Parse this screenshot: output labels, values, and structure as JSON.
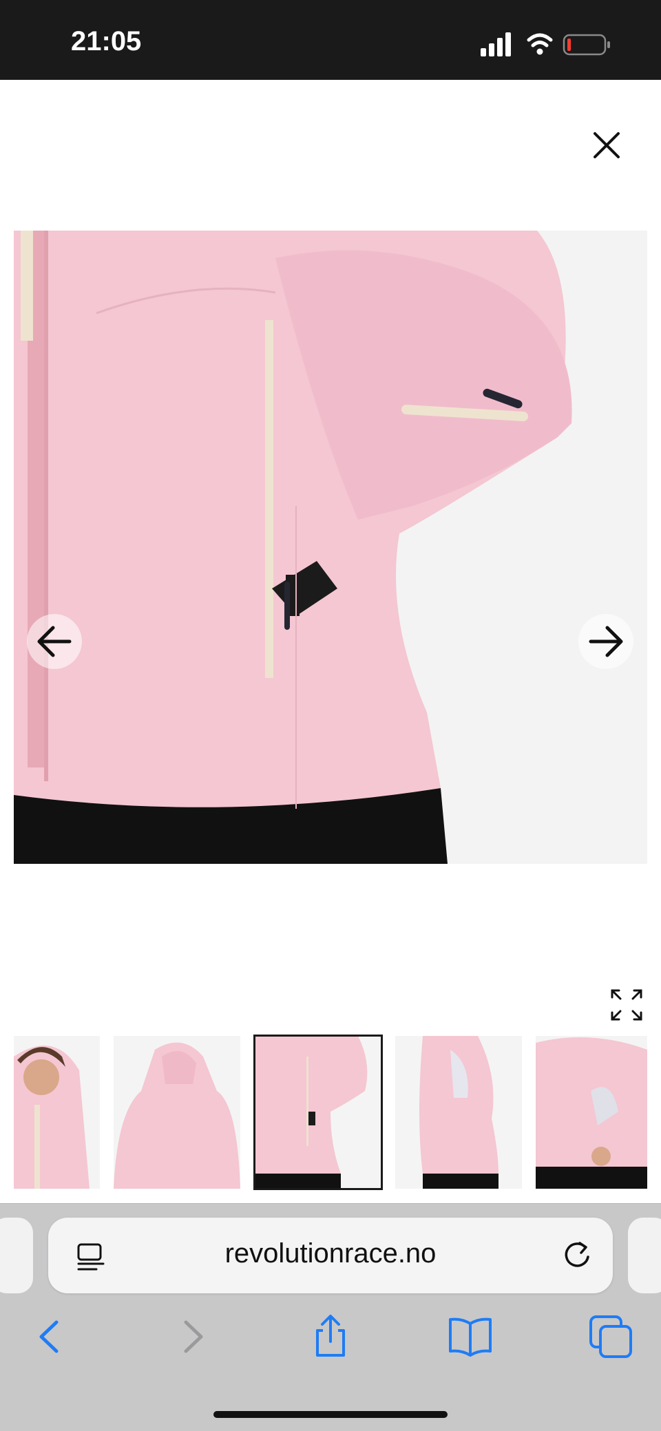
{
  "status_bar": {
    "time": "21:05"
  },
  "gallery": {
    "close_icon": "close-icon",
    "prev_icon": "arrow-left-icon",
    "next_icon": "arrow-right-icon",
    "expand_icon": "expand-icon",
    "main_image_alt": "Pink ski jacket, side pocket detail",
    "thumbnails": [
      {
        "alt": "Woman in pink jacket with hood, front view"
      },
      {
        "alt": "Pink jacket back view with hood"
      },
      {
        "alt": "Pink jacket side pocket detail",
        "selected": true
      },
      {
        "alt": "Pink jacket side view with open vent"
      },
      {
        "alt": "Pink jacket wrist pocket detail"
      }
    ]
  },
  "browser": {
    "url": "revolutionrace.no",
    "toolbar": [
      "back",
      "forward",
      "share",
      "bookmarks",
      "tabs"
    ]
  },
  "colors": {
    "jacket_pink": "#f4c7d2",
    "status_bar_bg": "#1a1a1a",
    "browser_bg": "#c8c8c9",
    "accent_blue": "#1e7cf5"
  }
}
